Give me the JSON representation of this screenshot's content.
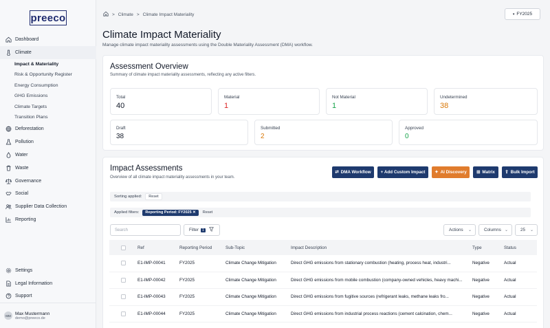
{
  "app": {
    "logo_text": "preeco"
  },
  "sidebar": {
    "items": [
      {
        "label": "Dashboard",
        "icon": "home-icon"
      },
      {
        "label": "Climate",
        "icon": "thermometer-icon"
      },
      {
        "label": "Deforestation",
        "icon": "globe-icon"
      },
      {
        "label": "Pollution",
        "icon": "flask-icon"
      },
      {
        "label": "Water",
        "icon": "droplet-icon"
      },
      {
        "label": "Waste",
        "icon": "trash-icon"
      },
      {
        "label": "Governance",
        "icon": "scale-icon"
      },
      {
        "label": "Social",
        "icon": "handshake-icon"
      },
      {
        "label": "Supplier Data Collection",
        "icon": "users-icon"
      },
      {
        "label": "Reporting",
        "icon": "chart-icon"
      }
    ],
    "climate_sub": [
      "Impact & Materiality",
      "Risk & Opportunity Register",
      "Energy Consumption",
      "GHG Emissions",
      "Climate Targets",
      "Transition Plans"
    ],
    "bottom": [
      {
        "label": "Settings",
        "icon": "gear-icon"
      },
      {
        "label": "Legal Information",
        "icon": "file-icon"
      },
      {
        "label": "Support",
        "icon": "help-icon"
      }
    ],
    "user": {
      "initials": "MM",
      "name": "Max Mustermann",
      "email": "demo@preeco.de"
    }
  },
  "header": {
    "breadcrumb": [
      "Climate",
      ">",
      "Climate Impact Materiality"
    ],
    "breadcrumb_sep": ">",
    "fiscal_year": "FY2025",
    "title": "Climate Impact Materiality",
    "description": "Manage climate impact materiality assessments using the Double Materiality Assessment (DMA) workflow."
  },
  "overview": {
    "title": "Assessment Overview",
    "subtitle": "Summary of climate impact materiality assessments, reflecting any active filters.",
    "stats": [
      {
        "label": "Total",
        "value": "40",
        "color": "#111827"
      },
      {
        "label": "Material",
        "value": "1",
        "color": "#dc2626"
      },
      {
        "label": "Not Material",
        "value": "1",
        "color": "#16a34a"
      },
      {
        "label": "Undetermined",
        "value": "38",
        "color": "#d97706"
      }
    ],
    "status_stats": [
      {
        "label": "Draft",
        "value": "38",
        "color": "#111827"
      },
      {
        "label": "Submitted",
        "value": "2",
        "color": "#d97706"
      },
      {
        "label": "Approved",
        "value": "0",
        "color": "#16a34a"
      }
    ]
  },
  "assessments": {
    "title": "Impact Assessments",
    "subtitle": "Overview of all climate impact materiality assessments in your team.",
    "buttons": {
      "dma": "DMA Workflow",
      "add": "+ Add Custom Impact",
      "ai": "AI Discovery",
      "matrix": "Matrix",
      "bulk": "Bulk Import"
    },
    "sorting_label": "Sorting applied:",
    "sorting_reset": "Reset",
    "filters_label": "Applied filters:",
    "filter_chip": "Reporting Period: FY2025 ✕",
    "filters_reset": "Reset",
    "search_placeholder": "Search",
    "filter_label": "Filter",
    "filter_count": "1",
    "actions_label": "Actions",
    "columns_label": "Columns",
    "page_size": "25",
    "columns": [
      "Ref",
      "Reporting Period",
      "Sub-Topic",
      "Impact Description",
      "Type",
      "Status"
    ],
    "rows": [
      {
        "ref": "E1-IMP-00041",
        "period": "FY2025",
        "subtopic": "Climate Change Mitigation",
        "desc": "Direct GHG emissions from stationary combustion (heating, process heat, industri...",
        "type": "Negative",
        "status": "Actual"
      },
      {
        "ref": "E1-IMP-00042",
        "period": "FY2025",
        "subtopic": "Climate Change Mitigation",
        "desc": "Direct GHG emissions from mobile combustion (company-owned vehicles, heavy machi...",
        "type": "Negative",
        "status": "Actual"
      },
      {
        "ref": "E1-IMP-00043",
        "period": "FY2025",
        "subtopic": "Climate Change Mitigation",
        "desc": "Direct GHG emissions from fugitive sources (refrigerant leaks, methane leaks fro...",
        "type": "Negative",
        "status": "Actual"
      },
      {
        "ref": "E1-IMP-00044",
        "period": "FY2025",
        "subtopic": "Climate Change Mitigation",
        "desc": "Direct GHG emissions from industrial process reactions (cement calcination, chem...",
        "type": "Negative",
        "status": "Actual"
      }
    ]
  }
}
